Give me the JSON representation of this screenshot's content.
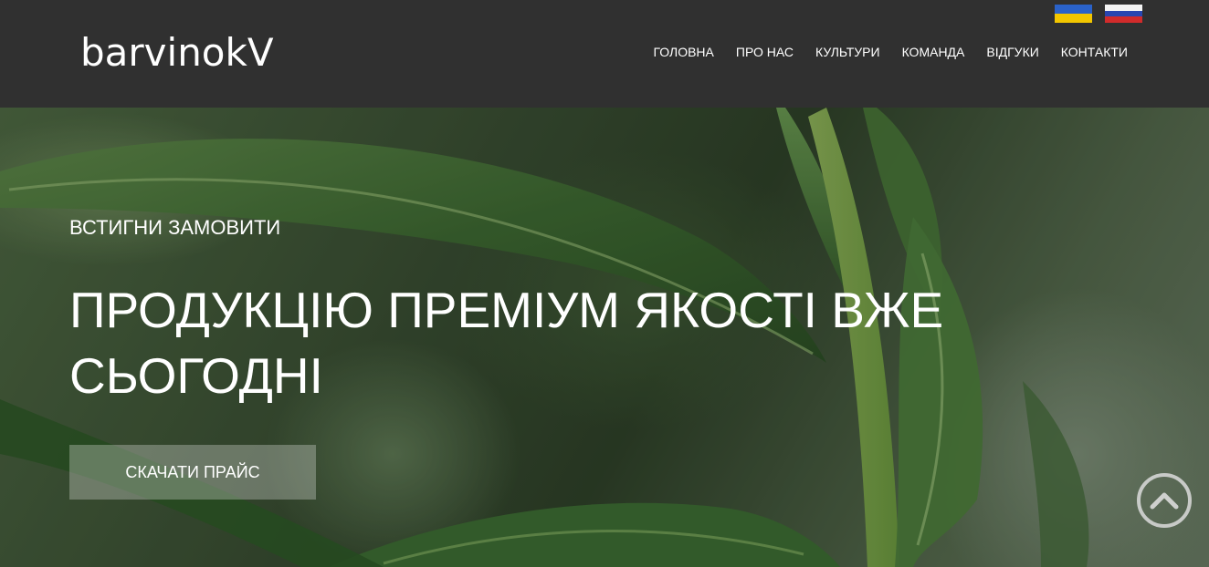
{
  "header": {
    "logo": "barvinokV",
    "languages": [
      {
        "code": "uk",
        "colors": [
          "#1f5fd1",
          "#f5c800"
        ]
      },
      {
        "code": "ru",
        "colors": [
          "#ffffff",
          "#1f3fb5",
          "#d42a2a"
        ]
      }
    ],
    "nav": [
      "ГОЛОВНА",
      "ПРО НАС",
      "КУЛЬТУРИ",
      "КОМАНДА",
      "ВІДГУКИ",
      "КОНТАКТИ"
    ]
  },
  "hero": {
    "subtitle": "ВСТИГНИ ЗАМОВИТИ",
    "headline": "ПРОДУКЦІЮ ПРЕМІУМ ЯКОСТІ ВЖЕ СЬОГОДНІ",
    "cta_label": "СКАЧАТИ ПРАЙС",
    "background_image": "green plant leaves photo"
  },
  "scroll_top": {
    "icon": "chevron-up-circle-icon"
  },
  "colors": {
    "header_bg": "#303030",
    "text": "#ffffff"
  }
}
